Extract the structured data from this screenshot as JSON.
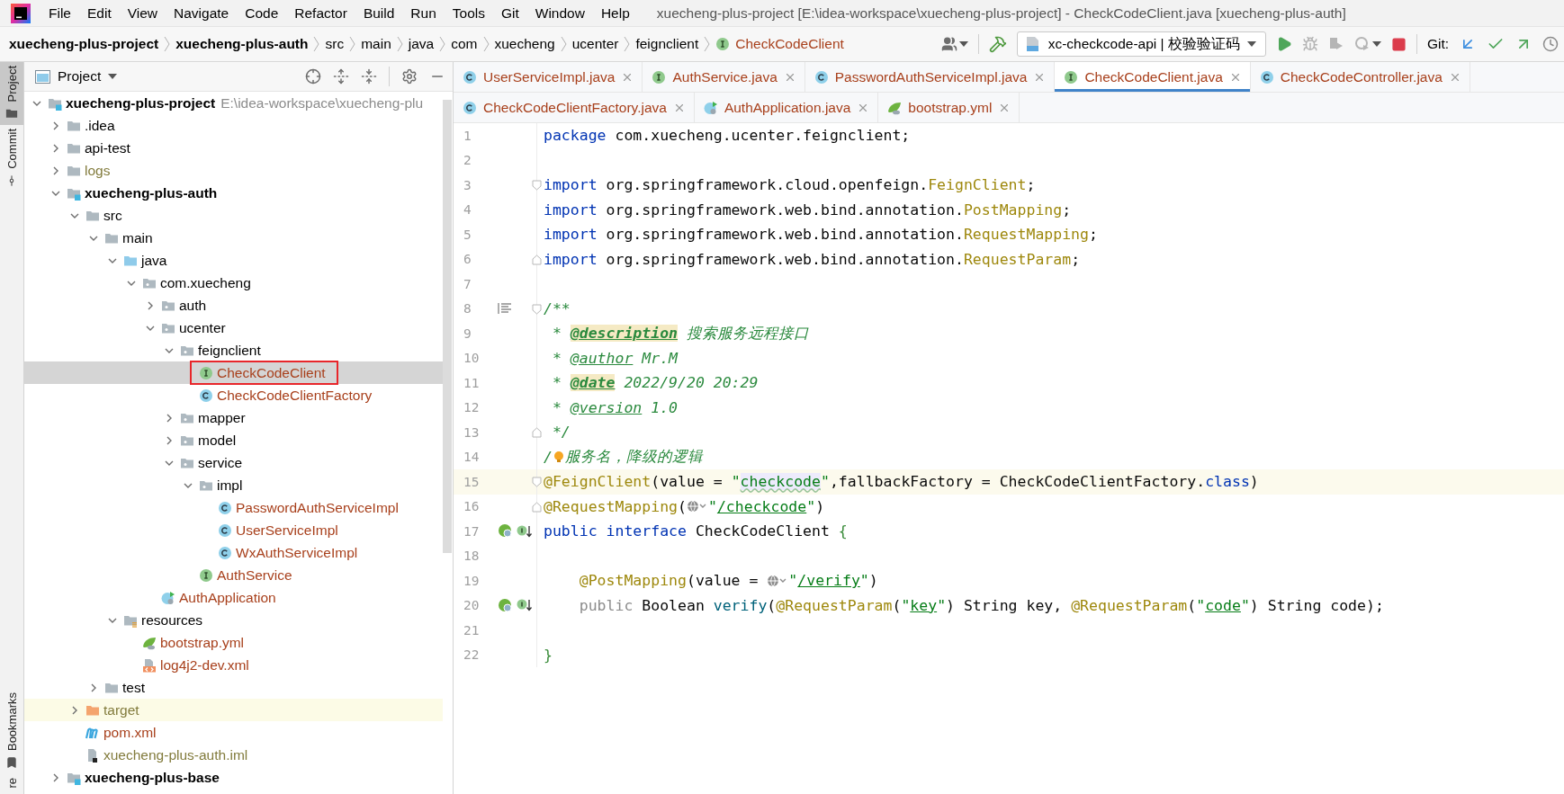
{
  "menu_bar": {
    "items": [
      "File",
      "Edit",
      "View",
      "Navigate",
      "Code",
      "Refactor",
      "Build",
      "Run",
      "Tools",
      "Git",
      "Window",
      "Help"
    ],
    "title": "xuecheng-plus-project [E:\\idea-workspace\\xuecheng-plus-project] - CheckCodeClient.java [xuecheng-plus-auth]"
  },
  "navbar": {
    "crumbs": [
      {
        "label": "xuecheng-plus-project",
        "kind": "module"
      },
      {
        "label": "xuecheng-plus-auth",
        "kind": "module"
      },
      {
        "label": "src",
        "kind": "folder"
      },
      {
        "label": "main",
        "kind": "folder"
      },
      {
        "label": "java",
        "kind": "folder"
      },
      {
        "label": "com",
        "kind": "folder"
      },
      {
        "label": "xuecheng",
        "kind": "folder"
      },
      {
        "label": "ucenter",
        "kind": "folder"
      },
      {
        "label": "feignclient",
        "kind": "folder"
      },
      {
        "label": "CheckCodeClient",
        "kind": "interface"
      }
    ],
    "run_config": "xc-checkcode-api | 校验验证码",
    "git_label": "Git:"
  },
  "tool_stripe": {
    "top": [
      {
        "label": "Project",
        "kind": "project",
        "selected": true
      },
      {
        "label": "Commit",
        "kind": "commit",
        "selected": false
      }
    ],
    "bottom": [
      {
        "label": "Bookmarks",
        "kind": "bookmarks",
        "selected": false
      },
      {
        "label": "re",
        "kind": "none",
        "selected": false
      }
    ]
  },
  "project_panel": {
    "title": "Project",
    "tree": [
      {
        "label": "xuecheng-plus-project",
        "path": "E:\\idea-workspace\\xuecheng-plu",
        "kind": "module",
        "color": "#000000",
        "expanded": true,
        "selected": false,
        "highlighted": false,
        "outlined": false,
        "children": [
          {
            "label": ".idea",
            "kind": "folder",
            "color": "#000000",
            "expanded": false,
            "selected": false,
            "highlighted": false,
            "outlined": false
          },
          {
            "label": "api-test",
            "kind": "folder",
            "color": "#000000",
            "expanded": false,
            "selected": false,
            "highlighted": false,
            "outlined": false
          },
          {
            "label": "logs",
            "kind": "folder",
            "color": "#827b3c",
            "expanded": false,
            "selected": false,
            "highlighted": false,
            "outlined": false
          },
          {
            "label": "xuecheng-plus-auth",
            "kind": "module",
            "color": "#000000",
            "expanded": true,
            "selected": false,
            "highlighted": false,
            "outlined": false,
            "children": [
              {
                "label": "src",
                "kind": "folder",
                "color": "#000000",
                "expanded": true,
                "selected": false,
                "highlighted": false,
                "outlined": false,
                "children": [
                  {
                    "label": "main",
                    "kind": "folder",
                    "color": "#000000",
                    "expanded": true,
                    "selected": false,
                    "highlighted": false,
                    "outlined": false,
                    "children": [
                      {
                        "label": "java",
                        "kind": "source",
                        "color": "#000000",
                        "expanded": true,
                        "selected": false,
                        "highlighted": false,
                        "outlined": false,
                        "children": [
                          {
                            "label": "com.xuecheng",
                            "kind": "package",
                            "color": "#000000",
                            "expanded": true,
                            "selected": false,
                            "highlighted": false,
                            "outlined": false,
                            "children": [
                              {
                                "label": "auth",
                                "kind": "package",
                                "color": "#000000",
                                "expanded": false,
                                "selected": false,
                                "highlighted": false,
                                "outlined": false
                              },
                              {
                                "label": "ucenter",
                                "kind": "package",
                                "color": "#000000",
                                "expanded": true,
                                "selected": false,
                                "highlighted": false,
                                "outlined": false,
                                "children": [
                                  {
                                    "label": "feignclient",
                                    "kind": "package",
                                    "color": "#000000",
                                    "expanded": true,
                                    "selected": false,
                                    "highlighted": false,
                                    "outlined": false,
                                    "children": [
                                      {
                                        "label": "CheckCodeClient",
                                        "kind": "interface",
                                        "color": "#a8401c",
                                        "selected": true,
                                        "highlighted": false,
                                        "outlined": true
                                      },
                                      {
                                        "label": "CheckCodeClientFactory",
                                        "kind": "class",
                                        "color": "#a8401c",
                                        "selected": false,
                                        "highlighted": false,
                                        "outlined": false
                                      }
                                    ]
                                  },
                                  {
                                    "label": "mapper",
                                    "kind": "package",
                                    "color": "#000000",
                                    "expanded": false,
                                    "selected": false,
                                    "highlighted": false,
                                    "outlined": false
                                  },
                                  {
                                    "label": "model",
                                    "kind": "package",
                                    "color": "#000000",
                                    "expanded": false,
                                    "selected": false,
                                    "highlighted": false,
                                    "outlined": false
                                  },
                                  {
                                    "label": "service",
                                    "kind": "package",
                                    "color": "#000000",
                                    "expanded": true,
                                    "selected": false,
                                    "highlighted": false,
                                    "outlined": false,
                                    "children": [
                                      {
                                        "label": "impl",
                                        "kind": "package",
                                        "color": "#000000",
                                        "expanded": true,
                                        "selected": false,
                                        "highlighted": false,
                                        "outlined": false,
                                        "children": [
                                          {
                                            "label": "PasswordAuthServiceImpl",
                                            "kind": "class",
                                            "color": "#a8401c",
                                            "selected": false,
                                            "highlighted": false,
                                            "outlined": false
                                          },
                                          {
                                            "label": "UserServiceImpl",
                                            "kind": "class",
                                            "color": "#a8401c",
                                            "selected": false,
                                            "highlighted": false,
                                            "outlined": false
                                          },
                                          {
                                            "label": "WxAuthServiceImpl",
                                            "kind": "class",
                                            "color": "#a8401c",
                                            "selected": false,
                                            "highlighted": false,
                                            "outlined": false
                                          }
                                        ]
                                      },
                                      {
                                        "label": "AuthService",
                                        "kind": "interface",
                                        "color": "#a8401c",
                                        "selected": false,
                                        "highlighted": false,
                                        "outlined": false
                                      }
                                    ]
                                  }
                                ]
                              },
                              {
                                "label": "AuthApplication",
                                "kind": "app",
                                "color": "#a8401c",
                                "selected": false,
                                "highlighted": false,
                                "outlined": false
                              }
                            ]
                          }
                        ]
                      },
                      {
                        "label": "resources",
                        "kind": "resources",
                        "color": "#000000",
                        "expanded": true,
                        "selected": false,
                        "highlighted": false,
                        "outlined": false,
                        "children": [
                          {
                            "label": "bootstrap.yml",
                            "kind": "yml",
                            "color": "#a8401c",
                            "selected": false,
                            "highlighted": false,
                            "outlined": false
                          },
                          {
                            "label": "log4j2-dev.xml",
                            "kind": "xml",
                            "color": "#a8401c",
                            "selected": false,
                            "highlighted": false,
                            "outlined": false
                          }
                        ]
                      }
                    ]
                  },
                  {
                    "label": "test",
                    "kind": "folder",
                    "color": "#000000",
                    "expanded": false,
                    "selected": false,
                    "highlighted": false,
                    "outlined": false
                  }
                ]
              },
              {
                "label": "target",
                "kind": "excluded",
                "color": "#827b3c",
                "expanded": false,
                "selected": false,
                "highlighted": true,
                "outlined": false
              },
              {
                "label": "pom.xml",
                "kind": "maven",
                "color": "#a8401c",
                "selected": false,
                "highlighted": false,
                "outlined": false
              },
              {
                "label": "xuecheng-plus-auth.iml",
                "kind": "iml",
                "color": "#827b3c",
                "selected": false,
                "highlighted": false,
                "outlined": false
              }
            ]
          },
          {
            "label": "xuecheng-plus-base",
            "kind": "module",
            "color": "#000000",
            "expanded": false,
            "selected": false,
            "highlighted": false,
            "outlined": false
          }
        ]
      }
    ]
  },
  "editor": {
    "tab_rows": [
      [
        {
          "label": "UserServiceImpl.java",
          "kind": "class",
          "selected": false
        },
        {
          "label": "AuthService.java",
          "kind": "interface",
          "selected": false
        },
        {
          "label": "PasswordAuthServiceImpl.java",
          "kind": "class",
          "selected": false
        },
        {
          "label": "CheckCodeClient.java",
          "kind": "interface",
          "selected": true
        },
        {
          "label": "CheckCodeController.java",
          "kind": "class",
          "selected": false
        }
      ],
      [
        {
          "label": "CheckCodeClientFactory.java",
          "kind": "class",
          "selected": false
        },
        {
          "label": "AuthApplication.java",
          "kind": "app",
          "selected": false
        },
        {
          "label": "bootstrap.yml",
          "kind": "yml",
          "selected": false
        }
      ]
    ],
    "lines": [
      {
        "number": "1",
        "current": false,
        "tokens": [
          {
            "kind": "kw",
            "text": "package"
          },
          {
            "kind": "plain",
            "text": " com.xuecheng.ucenter.feignclient;"
          }
        ]
      },
      {
        "number": "2",
        "current": false
      },
      {
        "number": "3",
        "current": false,
        "fold": {
          "kind": "start"
        },
        "tokens": [
          {
            "kind": "kw",
            "text": "import"
          },
          {
            "kind": "plain",
            "text": " org.springframework.cloud.openfeign."
          },
          {
            "kind": "ann",
            "text": "FeignClient"
          },
          {
            "kind": "plain",
            "text": ";"
          }
        ]
      },
      {
        "number": "4",
        "current": false,
        "tokens": [
          {
            "kind": "kw",
            "text": "import"
          },
          {
            "kind": "plain",
            "text": " org.springframework.web.bind.annotation."
          },
          {
            "kind": "ann",
            "text": "PostMapping"
          },
          {
            "kind": "plain",
            "text": ";"
          }
        ]
      },
      {
        "number": "5",
        "current": false,
        "tokens": [
          {
            "kind": "kw",
            "text": "import"
          },
          {
            "kind": "plain",
            "text": " org.springframework.web.bind.annotation."
          },
          {
            "kind": "ann",
            "text": "RequestMapping"
          },
          {
            "kind": "plain",
            "text": ";"
          }
        ]
      },
      {
        "number": "6",
        "current": false,
        "fold": {
          "kind": "end"
        },
        "tokens": [
          {
            "kind": "kw",
            "text": "import"
          },
          {
            "kind": "plain",
            "text": " org.springframework.web.bind.annotation."
          },
          {
            "kind": "ann",
            "text": "RequestParam"
          },
          {
            "kind": "plain",
            "text": ";"
          }
        ]
      },
      {
        "number": "7",
        "current": false
      },
      {
        "number": "8",
        "current": false,
        "fold": {
          "kind": "start"
        },
        "gutter": [
          {
            "kind": "doc"
          }
        ],
        "tokens": [
          {
            "kind": "doc",
            "text": "/**"
          }
        ]
      },
      {
        "number": "9",
        "current": false,
        "tokens": [
          {
            "kind": "doc",
            "text": " * "
          },
          {
            "kind": "doctag",
            "text": "@description"
          },
          {
            "kind": "doc",
            "text": " 搜索服务远程接口"
          }
        ]
      },
      {
        "number": "10",
        "current": false,
        "tokens": [
          {
            "kind": "doc",
            "text": " * "
          },
          {
            "kind": "docref",
            "text": "@author"
          },
          {
            "kind": "doc",
            "text": " Mr.M"
          }
        ]
      },
      {
        "number": "11",
        "current": false,
        "tokens": [
          {
            "kind": "doc",
            "text": " * "
          },
          {
            "kind": "doctag",
            "text": "@date"
          },
          {
            "kind": "doc",
            "text": " 2022/9/20 20:29"
          }
        ]
      },
      {
        "number": "12",
        "current": false,
        "tokens": [
          {
            "kind": "doc",
            "text": " * "
          },
          {
            "kind": "docref",
            "text": "@version"
          },
          {
            "kind": "doc",
            "text": " 1.0"
          }
        ]
      },
      {
        "number": "13",
        "current": false,
        "fold": {
          "kind": "end"
        },
        "tokens": [
          {
            "kind": "doc",
            "text": " */"
          }
        ]
      },
      {
        "number": "14",
        "current": false,
        "tokens": [
          {
            "kind": "doc",
            "text": "/"
          },
          {
            "kind": "bulb"
          },
          {
            "kind": "doc",
            "text": "服务名，降级的逻辑"
          }
        ]
      },
      {
        "number": "15",
        "current": true,
        "fold": {
          "kind": "start"
        },
        "tokens": [
          {
            "kind": "ann",
            "text": "@FeignClient"
          },
          {
            "kind": "plain",
            "text": "(value = "
          },
          {
            "kind": "str",
            "text": "\""
          },
          {
            "kind": "strhl",
            "text": "checkcode"
          },
          {
            "kind": "str",
            "text": "\""
          },
          {
            "kind": "plain",
            "text": ",fallbackFactory = CheckCodeClientFactory."
          },
          {
            "kind": "kw",
            "text": "class"
          },
          {
            "kind": "plain",
            "text": ")"
          }
        ]
      },
      {
        "number": "16",
        "current": false,
        "fold": {
          "kind": "end"
        },
        "tokens": [
          {
            "kind": "ann",
            "text": "@RequestMapping"
          },
          {
            "kind": "plain",
            "text": "("
          },
          {
            "kind": "inlay"
          },
          {
            "kind": "str",
            "text": "\""
          },
          {
            "kind": "strref",
            "text": "/checkcode"
          },
          {
            "kind": "str",
            "text": "\""
          },
          {
            "kind": "plain",
            "text": ")"
          }
        ]
      },
      {
        "number": "17",
        "current": false,
        "gutter": [
          {
            "kind": "bean"
          },
          {
            "kind": "implemented"
          }
        ],
        "tokens": [
          {
            "kind": "kw",
            "text": "public interface"
          },
          {
            "kind": "plain",
            "text": " CheckCodeClient "
          },
          {
            "kind": "brace",
            "text": "{"
          }
        ]
      },
      {
        "number": "18",
        "current": false
      },
      {
        "number": "19",
        "current": false,
        "indent": true,
        "tokens": [
          {
            "kind": "ann",
            "text": "@PostMapping"
          },
          {
            "kind": "plain",
            "text": "(value = "
          },
          {
            "kind": "inlay"
          },
          {
            "kind": "str",
            "text": "\""
          },
          {
            "kind": "strref",
            "text": "/verify"
          },
          {
            "kind": "str",
            "text": "\""
          },
          {
            "kind": "plain",
            "text": ")"
          }
        ]
      },
      {
        "number": "20",
        "current": false,
        "indent": true,
        "gutter": [
          {
            "kind": "bean"
          },
          {
            "kind": "implemented"
          }
        ],
        "tokens": [
          {
            "kind": "muted",
            "text": "public"
          },
          {
            "kind": "plain",
            "text": " Boolean "
          },
          {
            "kind": "method",
            "text": "verify"
          },
          {
            "kind": "plain",
            "text": "("
          },
          {
            "kind": "ann",
            "text": "@RequestParam"
          },
          {
            "kind": "plain",
            "text": "("
          },
          {
            "kind": "str",
            "text": "\""
          },
          {
            "kind": "strref",
            "text": "key"
          },
          {
            "kind": "str",
            "text": "\""
          },
          {
            "kind": "plain",
            "text": ") String key, "
          },
          {
            "kind": "ann",
            "text": "@RequestParam"
          },
          {
            "kind": "plain",
            "text": "("
          },
          {
            "kind": "str",
            "text": "\""
          },
          {
            "kind": "strref",
            "text": "code"
          },
          {
            "kind": "str",
            "text": "\""
          },
          {
            "kind": "plain",
            "text": ") String code);"
          }
        ]
      },
      {
        "number": "21",
        "current": false
      },
      {
        "number": "22",
        "current": false,
        "tokens": [
          {
            "kind": "brace",
            "text": "}"
          }
        ]
      }
    ]
  }
}
